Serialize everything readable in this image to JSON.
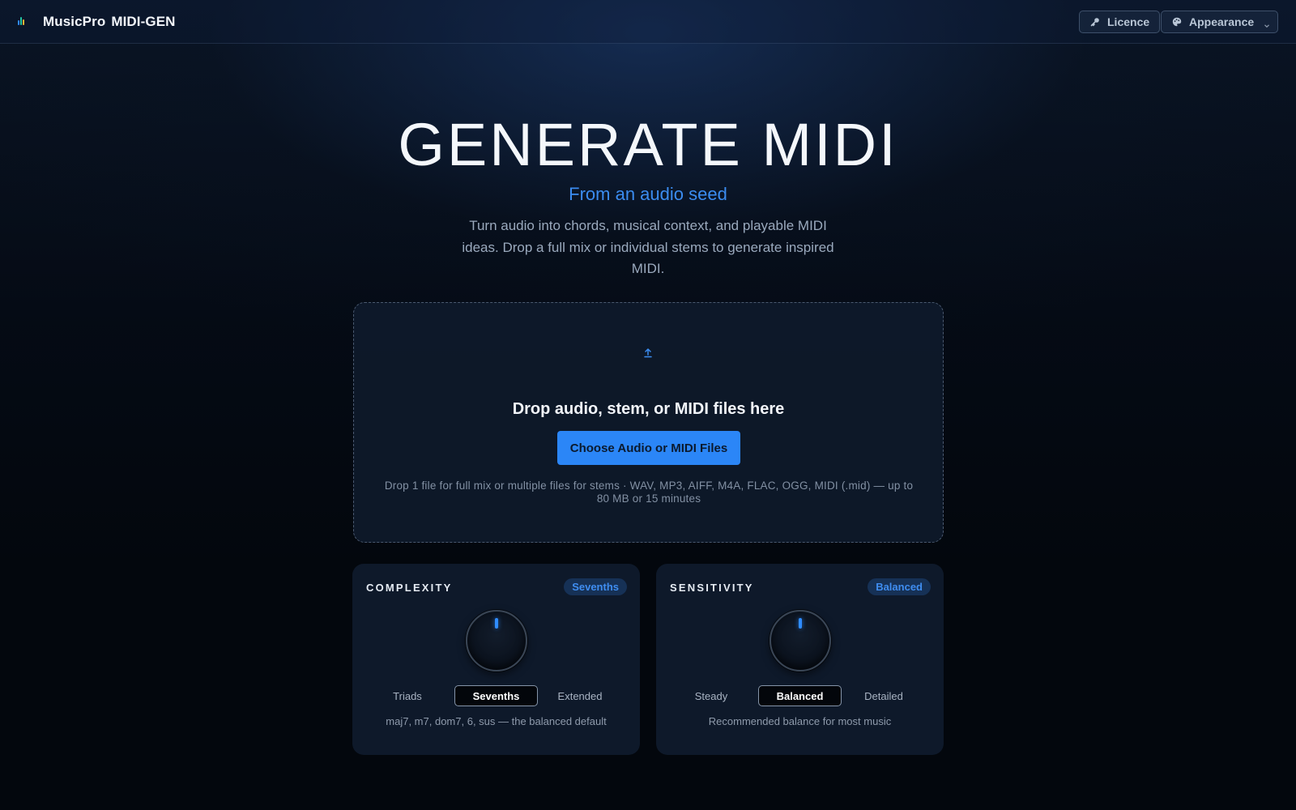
{
  "header": {
    "app_name_part1": "MusicPro",
    "app_name_part2": "MIDI-GEN",
    "licence_label": "Licence",
    "appearance_label": "Appearance",
    "icons": {
      "logo": "equalizer-bars-icon",
      "licence": "key-icon",
      "appearance": "palette-icon",
      "dropdown": "chevron-down-icon"
    }
  },
  "hero": {
    "title": "GENERATE MIDI",
    "subtitle": "From an audio seed",
    "description": "Turn audio into chords, musical context, and playable MIDI ideas. Drop a full mix or individual stems to generate inspired MIDI."
  },
  "dropzone": {
    "icon": "upload-arrow-icon",
    "title": "Drop audio, stem, or MIDI files here",
    "button_label": "Choose Audio or MIDI Files",
    "hint": "Drop 1 file for full mix or multiple files for stems · WAV, MP3, AIFF, M4A, FLAC, OGG, MIDI (.mid) — up to 80 MB or 15 minutes"
  },
  "complexity": {
    "label": "COMPLEXITY",
    "badge": "Sevenths",
    "options": [
      "Triads",
      "Sevenths",
      "Extended"
    ],
    "selected": "Sevenths",
    "note": "maj7, m7, dom7, 6, sus — the balanced default"
  },
  "sensitivity": {
    "label": "SENSITIVITY",
    "badge": "Balanced",
    "options": [
      "Steady",
      "Balanced",
      "Detailed"
    ],
    "selected": "Balanced",
    "note": "Recommended balance for most music"
  },
  "colors": {
    "accent": "#2b86f7",
    "background": "#03070d",
    "card": "#101c2e"
  }
}
